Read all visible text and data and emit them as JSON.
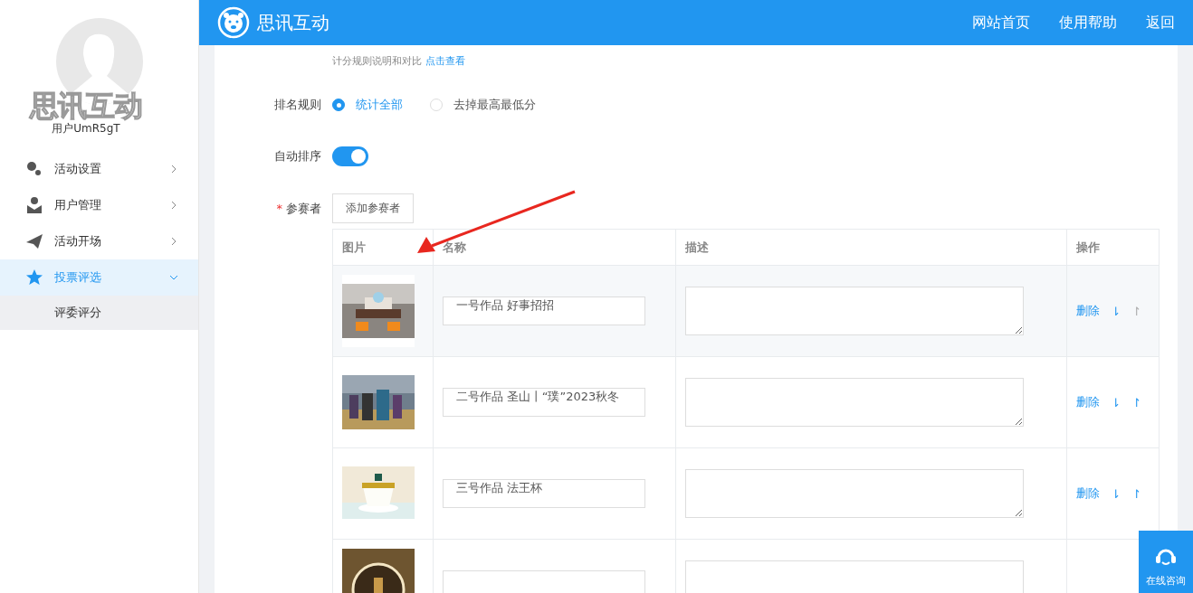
{
  "sidebar": {
    "brand_text": "思讯互动",
    "username": "用户UmR5gT",
    "items": [
      {
        "label": "活动设置",
        "expanded": false,
        "selected": false
      },
      {
        "label": "用户管理",
        "expanded": false,
        "selected": false
      },
      {
        "label": "活动开场",
        "expanded": false,
        "selected": false
      },
      {
        "label": "投票评选",
        "expanded": true,
        "selected": true,
        "children": [
          {
            "label": "评委评分",
            "selected": false
          }
        ]
      }
    ]
  },
  "header": {
    "title": "思讯互动",
    "links": [
      "网站首页",
      "使用帮助",
      "返回"
    ]
  },
  "form": {
    "rule_note": "计分规则说明和对比",
    "rule_link": "点击查看",
    "ranking_label": "排名规则",
    "ranking_options": [
      {
        "label": "统计全部",
        "selected": true
      },
      {
        "label": "去掉最高最低分",
        "selected": false
      }
    ],
    "auto_sort_label": "自动排序",
    "auto_sort_on": true,
    "participants_label": "参赛者",
    "required_mark": "*",
    "add_button": "添加参赛者"
  },
  "table": {
    "columns": [
      "图片",
      "名称",
      "描述",
      "操作"
    ],
    "rows": [
      {
        "kind": "full",
        "name": "一号作品  好事招招",
        "delete": "删除",
        "down": "⇂",
        "up": "↾",
        "up_disabled": true
      },
      {
        "kind": "full",
        "name": "二号作品  圣山丨“璞”2023秋冬",
        "delete": "删除",
        "down": "⇂",
        "up": "↾",
        "up_disabled": false
      },
      {
        "kind": "full",
        "name": "三号作品  法王杯",
        "delete": "删除",
        "down": "⇂",
        "up": "↾",
        "up_disabled": false
      },
      {
        "kind": "cut"
      }
    ]
  },
  "chat_widget": {
    "label": "在线咨询"
  }
}
